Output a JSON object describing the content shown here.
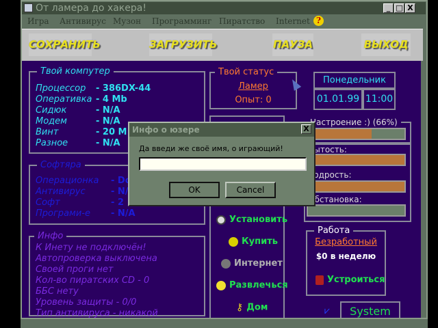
{
  "window": {
    "title": "От ламера до хакера!",
    "min": "_",
    "max": "□",
    "close": "X"
  },
  "menu": [
    "Игра",
    "Антивирус",
    "Музон",
    "Программинг",
    "Пиратство",
    "Internet"
  ],
  "help_icon": "?",
  "toolbar": {
    "save": "СОХРАНИТЬ",
    "load": "ЗАГРУЗИТЬ",
    "pause": "ПАУЗА",
    "exit": "ВЫХОД"
  },
  "computer": {
    "title": "Твой компутер",
    "rows": [
      {
        "k": "Процессор",
        "v": "-  386DX-44"
      },
      {
        "k": "Оперативка",
        "v": "- 4 Mb"
      },
      {
        "k": "Сидюк",
        "v": "-  N/A"
      },
      {
        "k": "Модем",
        "v": "-  N/A"
      },
      {
        "k": "Винт",
        "v": "-  20 M"
      },
      {
        "k": "Разное",
        "v": "-  N/A"
      }
    ]
  },
  "software": {
    "title": "Софтяра",
    "rows": [
      {
        "k": "Операционка",
        "v": "- Do"
      },
      {
        "k": "Антивирус",
        "v": "- N/A"
      },
      {
        "k": "Софт",
        "v": "- 2"
      },
      {
        "k": "Програми-е",
        "v": "- N/A"
      }
    ]
  },
  "info": {
    "title": "Инфо",
    "lines": [
      "К Инету не подключён!",
      "Автопроверка выключена",
      "Своей проги нет",
      "Кол-во пиратских CD - 0",
      "ББС нету",
      "Уровень защиты - 0/0",
      "Тип антивируса -  никакой"
    ]
  },
  "status": {
    "title": "Твой статус",
    "rank": "Ламер",
    "exp": "Опыт: 0"
  },
  "date": {
    "day": "Понедельник",
    "date": "01.01.99",
    "time": "11:00"
  },
  "mood": {
    "label": "Настроение :) (66%)",
    "value": 66
  },
  "stats": [
    {
      "label": "Сытость:",
      "value": 100
    },
    {
      "label": "Бодрость:",
      "value": 100
    },
    {
      "label": "Обстановка:",
      "value": 0
    }
  ],
  "actions": [
    "Установить",
    "Купить",
    "Интернет",
    "Развлечься",
    "Дом"
  ],
  "work": {
    "title": "Работа",
    "job": "Безработный",
    "salary": "$0 в неделю",
    "apply": "Устроиться"
  },
  "system_btn": "System",
  "dialog": {
    "title": "Инфо о юзере",
    "prompt": "Да введи же своё имя, о играющий!",
    "value": "",
    "ok": "OK",
    "cancel": "Cancel",
    "close": "X"
  }
}
